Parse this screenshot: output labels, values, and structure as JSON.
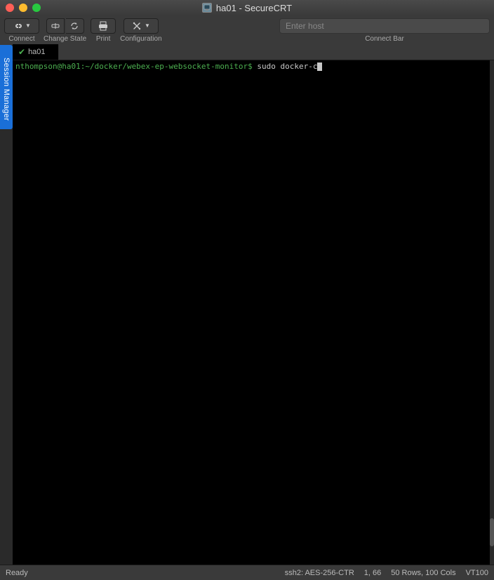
{
  "window": {
    "title": "ha01 - SecureCRT"
  },
  "toolbar": {
    "connect_label": "Connect",
    "change_state_label": "Change State",
    "print_label": "Print",
    "config_label": "Configuration",
    "connect_bar_label": "Connect Bar",
    "host_placeholder": "Enter host"
  },
  "session_manager_label": "Session Manager",
  "tabs": [
    {
      "label": "ha01"
    }
  ],
  "terminal": {
    "prompt": "nthompson@ha01:~/docker/webex-ep-websocket-monitor$",
    "command": " sudo docker-c"
  },
  "statusbar": {
    "ready": "Ready",
    "protocol": "ssh2: AES-256-CTR",
    "position": "1,  66",
    "rows_cols": "50 Rows, 100 Cols",
    "term": "VT100"
  }
}
